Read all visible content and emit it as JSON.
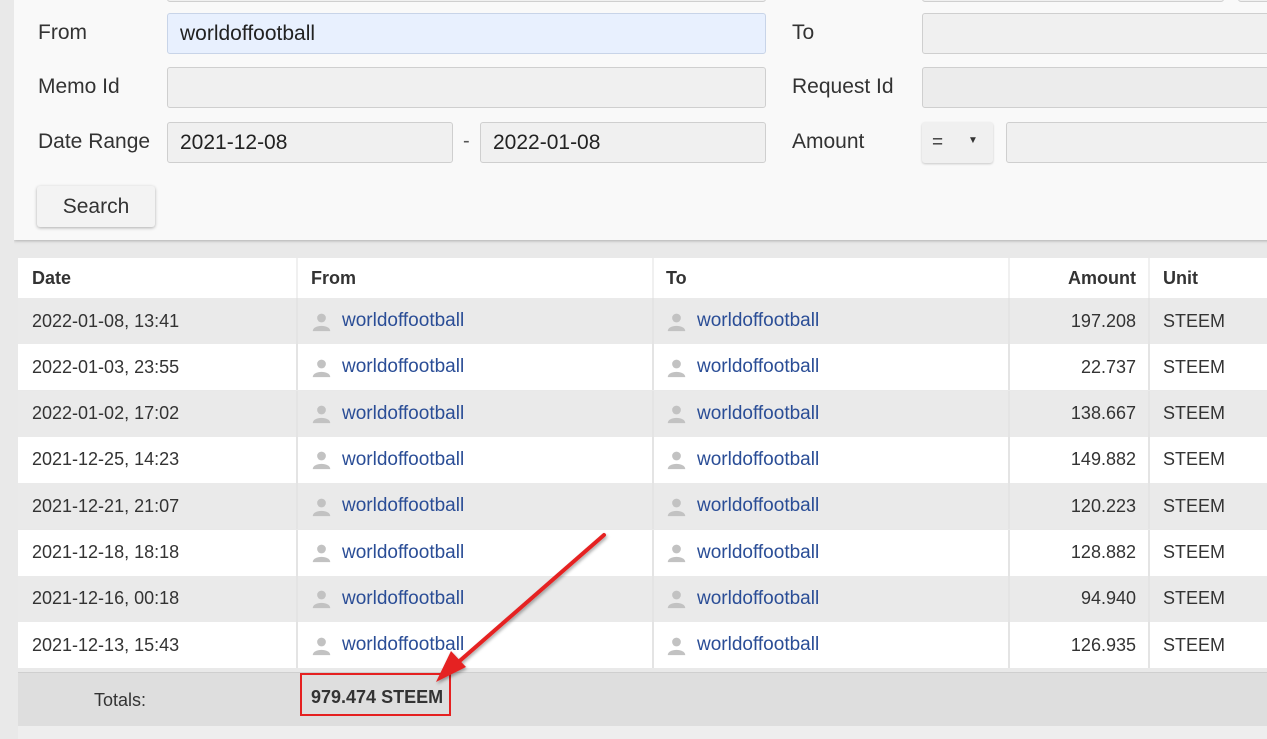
{
  "filters": {
    "from_label": "From",
    "from_value": "worldoffootball",
    "to_label": "To",
    "to_value": "",
    "memo_label": "Memo Id",
    "memo_value": "",
    "request_label": "Request Id",
    "request_value": "",
    "date_label": "Date Range",
    "date_start": "2021-12-08",
    "date_sep": "-",
    "date_end": "2022-01-08",
    "amount_label": "Amount",
    "amount_operator": "=",
    "amount_value": "",
    "search_label": "Search"
  },
  "table": {
    "headers": {
      "date": "Date",
      "from": "From",
      "to": "To",
      "amount": "Amount",
      "unit": "Unit"
    },
    "rows": [
      {
        "date": "2022-01-08, 13:41",
        "from": "worldoffootball",
        "to": "worldoffootball",
        "amount": "197.208",
        "unit": "STEEM"
      },
      {
        "date": "2022-01-03, 23:55",
        "from": "worldoffootball",
        "to": "worldoffootball",
        "amount": "22.737",
        "unit": "STEEM"
      },
      {
        "date": "2022-01-02, 17:02",
        "from": "worldoffootball",
        "to": "worldoffootball",
        "amount": "138.667",
        "unit": "STEEM"
      },
      {
        "date": "2021-12-25, 14:23",
        "from": "worldoffootball",
        "to": "worldoffootball",
        "amount": "149.882",
        "unit": "STEEM"
      },
      {
        "date": "2021-12-21, 21:07",
        "from": "worldoffootball",
        "to": "worldoffootball",
        "amount": "120.223",
        "unit": "STEEM"
      },
      {
        "date": "2021-12-18, 18:18",
        "from": "worldoffootball",
        "to": "worldoffootball",
        "amount": "128.882",
        "unit": "STEEM"
      },
      {
        "date": "2021-12-16, 00:18",
        "from": "worldoffootball",
        "to": "worldoffootball",
        "amount": "94.940",
        "unit": "STEEM"
      },
      {
        "date": "2021-12-13, 15:43",
        "from": "worldoffootball",
        "to": "worldoffootball",
        "amount": "126.935",
        "unit": "STEEM"
      }
    ],
    "totals_label": "Totals:",
    "totals_value": "979.474 STEEM"
  },
  "annotation": {
    "color": "#e52020",
    "icon": "red-arrow-icon"
  },
  "colors": {
    "link": "#2a4d96",
    "active_input": "#e8f0fe"
  }
}
